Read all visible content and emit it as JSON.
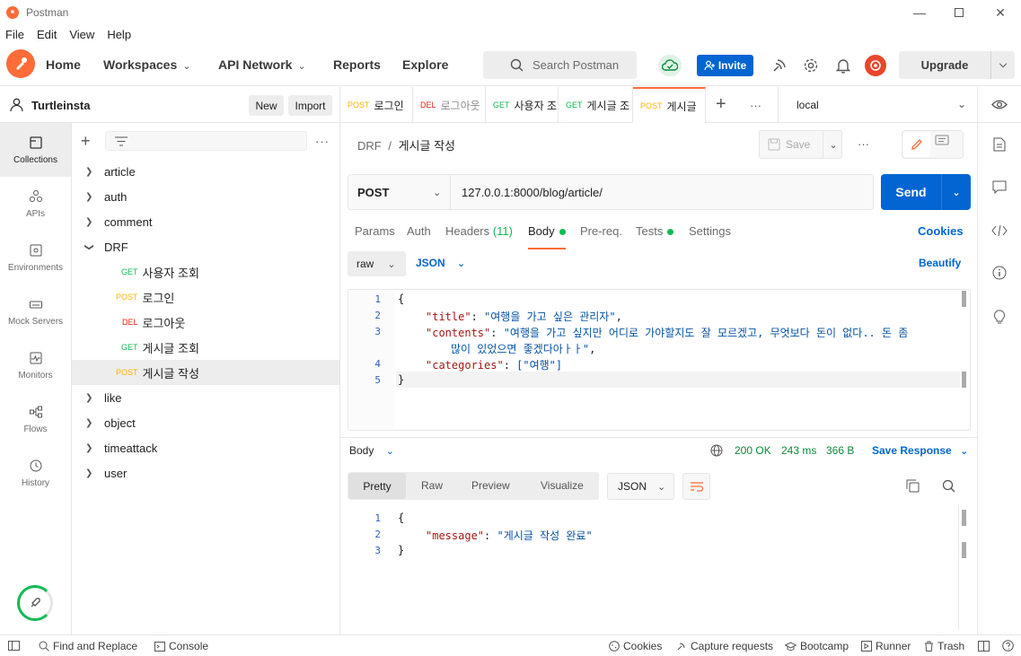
{
  "window": {
    "title": "Postman"
  },
  "menu": [
    "File",
    "Edit",
    "View",
    "Help"
  ],
  "nav": {
    "home": "Home",
    "workspaces": "Workspaces",
    "api_network": "API Network",
    "reports": "Reports",
    "explore": "Explore"
  },
  "search": {
    "placeholder": "Search Postman"
  },
  "invite_label": "Invite",
  "upgrade_label": "Upgrade",
  "workspace": {
    "name": "Turtleinsta",
    "new_label": "New",
    "import_label": "Import"
  },
  "leftnav": [
    {
      "label": "Collections",
      "icon": "collections-icon"
    },
    {
      "label": "APIs",
      "icon": "apis-icon"
    },
    {
      "label": "Environments",
      "icon": "environments-icon"
    },
    {
      "label": "Mock Servers",
      "icon": "mock-servers-icon"
    },
    {
      "label": "Monitors",
      "icon": "monitors-icon"
    },
    {
      "label": "Flows",
      "icon": "flows-icon"
    },
    {
      "label": "History",
      "icon": "history-icon"
    }
  ],
  "tree": {
    "folders_top": [
      "article",
      "auth",
      "comment",
      "DRF"
    ],
    "drf_items": [
      {
        "method": "GET",
        "label": "사용자 조회"
      },
      {
        "method": "POST",
        "label": "로그인"
      },
      {
        "method": "DEL",
        "label": "로그아웃"
      },
      {
        "method": "GET",
        "label": "게시글 조회"
      },
      {
        "method": "POST",
        "label": "게시글 작성"
      }
    ],
    "folders_bottom": [
      "like",
      "object",
      "timeattack",
      "user"
    ]
  },
  "tabs": [
    {
      "method": "POST",
      "label": "로그인"
    },
    {
      "method": "DEL",
      "label": "로그아웃"
    },
    {
      "method": "GET",
      "label": "사용자 조"
    },
    {
      "method": "GET",
      "label": "게시글 조"
    },
    {
      "method": "POST",
      "label": "게시글"
    }
  ],
  "environment": "local",
  "breadcrumb": {
    "collection": "DRF",
    "sep": "/",
    "request": "게시글 작성"
  },
  "save_label": "Save",
  "request": {
    "method": "POST",
    "url": "127.0.0.1:8000/blog/article/",
    "send_label": "Send"
  },
  "request_tabs": {
    "params": "Params",
    "auth": "Auth",
    "headers": "Headers",
    "headers_count": "(11)",
    "body": "Body",
    "prereq": "Pre-req.",
    "tests": "Tests",
    "settings": "Settings",
    "cookies": "Cookies"
  },
  "body_options": {
    "mode": "raw",
    "format": "JSON",
    "beautify": "Beautify"
  },
  "request_body": {
    "lines": [
      "1",
      "2",
      "3",
      "4",
      "5"
    ],
    "open": "{",
    "title_key": "\"title\"",
    "title_val": "\"여행을 가고 싶은 관리자\"",
    "contents_key": "\"contents\"",
    "contents_val_1": "\"여행을 가고 싶지만 어디로 가야할지도 잘 모르겠고, 무엇보다 돈이 없다.. 돈 좀",
    "contents_val_2": "많이 있었으면 좋겠다아ㅏㅏ\"",
    "categories_key": "\"categories\"",
    "categories_val": "[\"여행\"]",
    "close": "}"
  },
  "response": {
    "label": "Body",
    "status": "200 OK",
    "time": "243 ms",
    "size": "366 B",
    "save_label": "Save Response",
    "view_tabs": [
      "Pretty",
      "Raw",
      "Preview",
      "Visualize"
    ],
    "format": "JSON",
    "lines": [
      "1",
      "2",
      "3"
    ],
    "open": "{",
    "message_key": "\"message\"",
    "message_val": "\"게시글 작성 완료\"",
    "close": "}"
  },
  "footer": {
    "find_replace": "Find and Replace",
    "console": "Console",
    "cookies": "Cookies",
    "capture": "Capture requests",
    "bootcamp": "Bootcamp",
    "runner": "Runner",
    "trash": "Trash"
  },
  "colors": {
    "accent": "#ff6c37",
    "primary": "#0265d2",
    "get": "#0cbb52",
    "post": "#ffb400",
    "del": "#eb2013"
  }
}
